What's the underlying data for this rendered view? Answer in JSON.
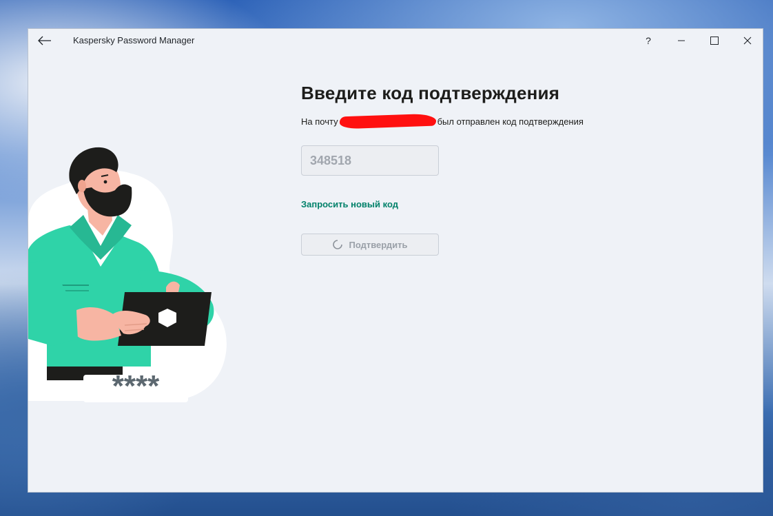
{
  "window": {
    "title": "Kaspersky Password Manager",
    "controls": {
      "help": "?",
      "minimize": "—",
      "maximize": "☐",
      "close": "✕"
    }
  },
  "page": {
    "heading": "Введите код подтверждения",
    "subtext_before": "На почту ",
    "subtext_after": "был отправлен код подтверждения",
    "code_value": "348518",
    "resend_label": "Запросить новый код",
    "confirm_label": "Подтвердить"
  },
  "illustration": {
    "password_mask": "****"
  },
  "colors": {
    "accent": "#00816a",
    "shirt": "#2fd3a8",
    "window_bg": "#eff2f7"
  }
}
